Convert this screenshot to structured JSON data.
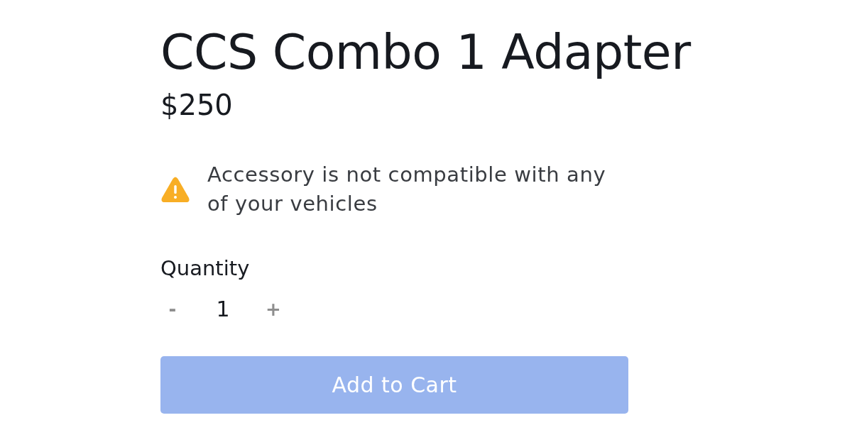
{
  "product": {
    "title": "CCS Combo 1 Adapter",
    "price": "$250"
  },
  "notice": {
    "kind": "warning",
    "text": "Accessory is not compatible with any of your vehicles"
  },
  "quantity": {
    "label": "Quantity",
    "decrement": "-",
    "value": "1",
    "increment": "+"
  },
  "add_to_cart": {
    "label": "Add to Cart",
    "disabled": true
  }
}
